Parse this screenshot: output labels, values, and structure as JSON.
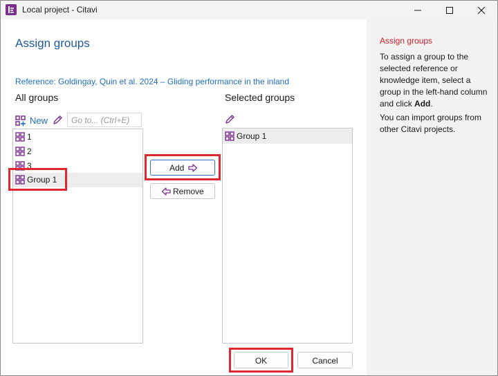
{
  "window": {
    "title": "Local project - Citavi",
    "minimize_icon": "minimize-icon",
    "maximize_icon": "maximize-icon",
    "close_icon": "close-icon"
  },
  "dialog": {
    "heading": "Assign groups",
    "reference": "Reference: Goldingay, Quin et al. 2024 – Gliding performance in the inland"
  },
  "all_groups": {
    "label": "All groups",
    "new_label": "New",
    "search_placeholder": "Go to... (Ctrl+E)",
    "items": [
      "1",
      "2",
      "3",
      "Group 1"
    ],
    "selected_item": "Group 1"
  },
  "selected_groups": {
    "label": "Selected groups",
    "items": [
      "Group 1"
    ]
  },
  "actions": {
    "add_label": "Add",
    "remove_label": "Remove",
    "ok_label": "OK",
    "cancel_label": "Cancel"
  },
  "help": {
    "title": "Assign groups",
    "p1_text": "To assign a group to the selected reference or knowledge item, select a group in the left-hand column and click ",
    "p1_bold": "Add",
    "p1_end": ".",
    "p2": "You can import groups from other Citavi projects."
  },
  "colors": {
    "accent_purple": "#7b2f8e",
    "heading_blue": "#1f5a9a",
    "link_blue": "#1f6fbf",
    "highlight_red": "#e0262f",
    "help_title_red": "#d0202a"
  }
}
